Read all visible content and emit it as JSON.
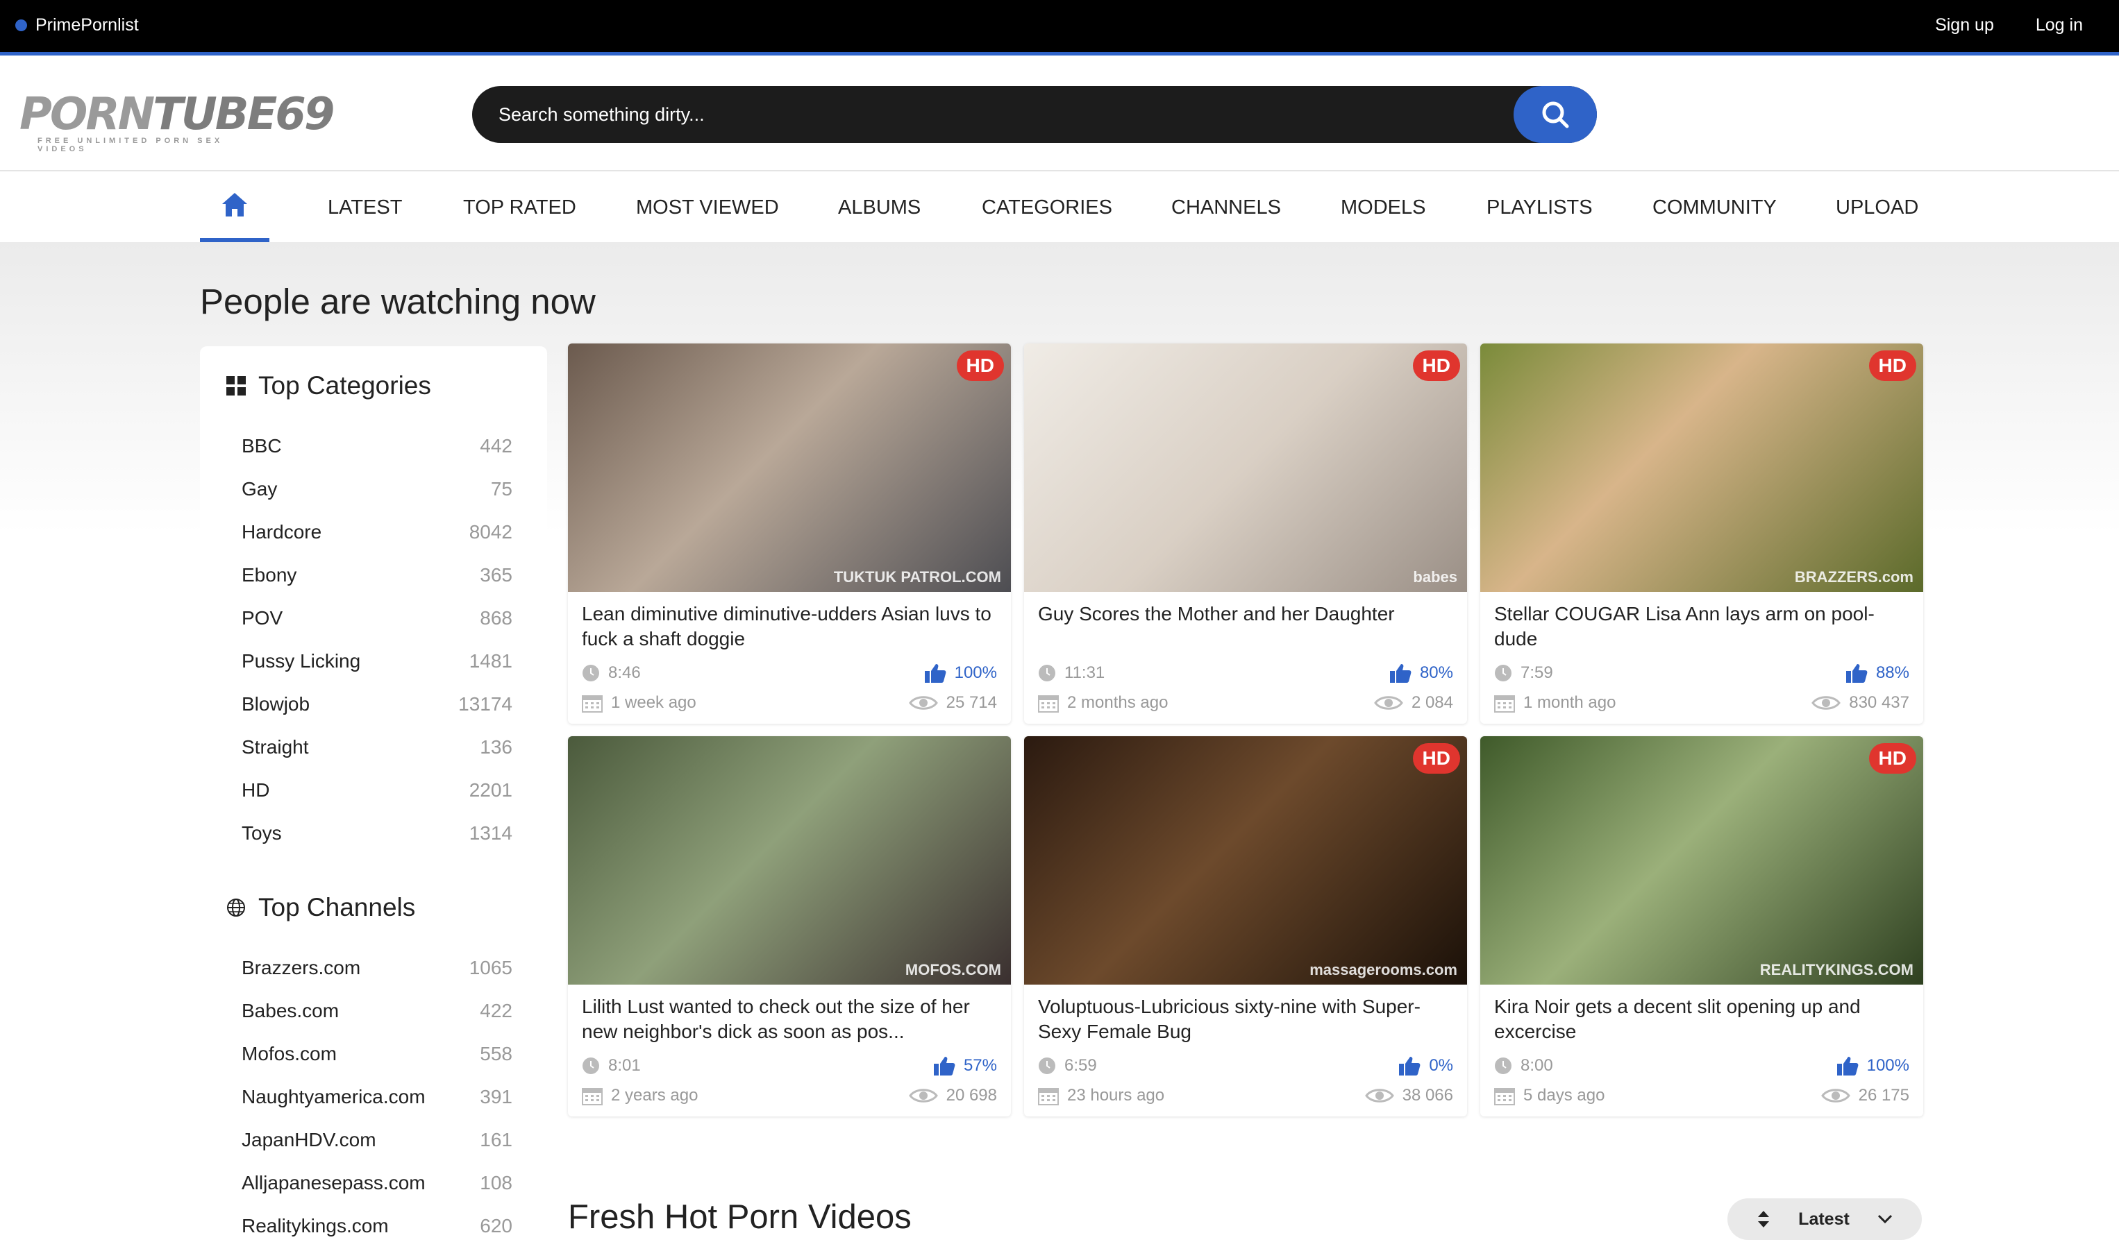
{
  "topbar": {
    "brand": "PrimePornlist",
    "signup": "Sign up",
    "login": "Log in"
  },
  "logo": {
    "word_a": "PORN",
    "word_b": "TUBE69",
    "tagline": "FREE UNLIMITED PORN SEX VIDEOS"
  },
  "search": {
    "placeholder": "Search something dirty..."
  },
  "nav": {
    "home_icon": "home-icon",
    "items": [
      "LATEST",
      "TOP RATED",
      "MOST VIEWED",
      "ALBUMS",
      "CATEGORIES",
      "CHANNELS",
      "MODELS",
      "PLAYLISTS",
      "COMMUNITY",
      "UPLOAD"
    ]
  },
  "section_title": "People are watching now",
  "sidebar": {
    "categories_title": "Top Categories",
    "categories": [
      {
        "name": "BBC",
        "count": "442"
      },
      {
        "name": "Gay",
        "count": "75"
      },
      {
        "name": "Hardcore",
        "count": "8042"
      },
      {
        "name": "Ebony",
        "count": "365"
      },
      {
        "name": "POV",
        "count": "868"
      },
      {
        "name": "Pussy Licking",
        "count": "1481"
      },
      {
        "name": "Blowjob",
        "count": "13174"
      },
      {
        "name": "Straight",
        "count": "136"
      },
      {
        "name": "HD",
        "count": "2201"
      },
      {
        "name": "Toys",
        "count": "1314"
      }
    ],
    "channels_title": "Top Channels",
    "channels": [
      {
        "name": "Brazzers.com",
        "count": "1065"
      },
      {
        "name": "Babes.com",
        "count": "422"
      },
      {
        "name": "Mofos.com",
        "count": "558"
      },
      {
        "name": "Naughtyamerica.com",
        "count": "391"
      },
      {
        "name": "JapanHDV.com",
        "count": "161"
      },
      {
        "name": "Alljapanesepass.com",
        "count": "108"
      },
      {
        "name": "Realitykings.com",
        "count": "620"
      }
    ]
  },
  "videos": [
    {
      "title": "Lean diminutive diminutive-udders Asian luvs to fuck a shaft doggie",
      "duration": "8:46",
      "rating": "100%",
      "age": "1 week ago",
      "views": "25 714",
      "hd": "HD",
      "watermark": "TUKTUK PATROL.COM"
    },
    {
      "title": "Guy Scores the Mother and her Daughter",
      "duration": "11:31",
      "rating": "80%",
      "age": "2 months ago",
      "views": "2 084",
      "hd": "HD",
      "watermark": "babes"
    },
    {
      "title": "Stellar COUGAR Lisa Ann lays arm on pool-dude",
      "duration": "7:59",
      "rating": "88%",
      "age": "1 month ago",
      "views": "830 437",
      "hd": "HD",
      "watermark": "BRAZZERS.com"
    },
    {
      "title": "Lilith Lust wanted to check out the size of her new neighbor's dick as soon as pos...",
      "duration": "8:01",
      "rating": "57%",
      "age": "2 years ago",
      "views": "20 698",
      "hd": "",
      "watermark": "MOFOS.COM"
    },
    {
      "title": "Voluptuous-Lubricious sixty-nine with Super-Sexy Female Bug",
      "duration": "6:59",
      "rating": "0%",
      "age": "23 hours ago",
      "views": "38 066",
      "hd": "HD",
      "watermark": "massagerooms.com"
    },
    {
      "title": "Kira Noir gets a decent slit opening up and excercise",
      "duration": "8:00",
      "rating": "100%",
      "age": "5 days ago",
      "views": "26 175",
      "hd": "HD",
      "watermark": "REALITYKINGS.COM"
    }
  ],
  "fresh": {
    "title": "Fresh Hot Porn Videos",
    "sort_label": "Latest"
  },
  "colors": {
    "accent": "#2f63c8",
    "hd_badge": "#e0352e",
    "topbar": "#000000"
  }
}
